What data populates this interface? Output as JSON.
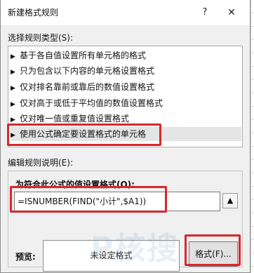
{
  "window": {
    "title": "新建格式规则",
    "help_label": "?",
    "close_label": "✕"
  },
  "rule_type": {
    "label": "选择规则类型(S):",
    "items": [
      {
        "label": "基于各自值设置所有单元格的格式"
      },
      {
        "label": "只为包含以下内容的单元格设置格式"
      },
      {
        "label": "仅对排名靠前或靠后的数值设置格式"
      },
      {
        "label": "仅对高于或低于平均值的数值设置格式"
      },
      {
        "label": "仅对唯一值或重复值设置格式"
      },
      {
        "label": "使用公式确定要设置格式的单元格",
        "selected": true
      }
    ]
  },
  "description": {
    "label": "编辑规则说明(E):",
    "formula_heading": "为符合此公式的值设置格式(O):",
    "formula_value": "=ISNUMBER(FIND(\"小计\",$A1))",
    "ref_button_icon": "collapse-dialog-icon",
    "preview_label": "预览:",
    "preview_text": "未设定格式",
    "format_button_label": "格式(F)..."
  },
  "watermark": {
    "text": "P核搜"
  },
  "colors": {
    "highlight_box": "#d9262c",
    "dialog_bg": "#f0f0f0",
    "list_bg": "#ffffff",
    "selected_bg": "#e5e5e5"
  }
}
